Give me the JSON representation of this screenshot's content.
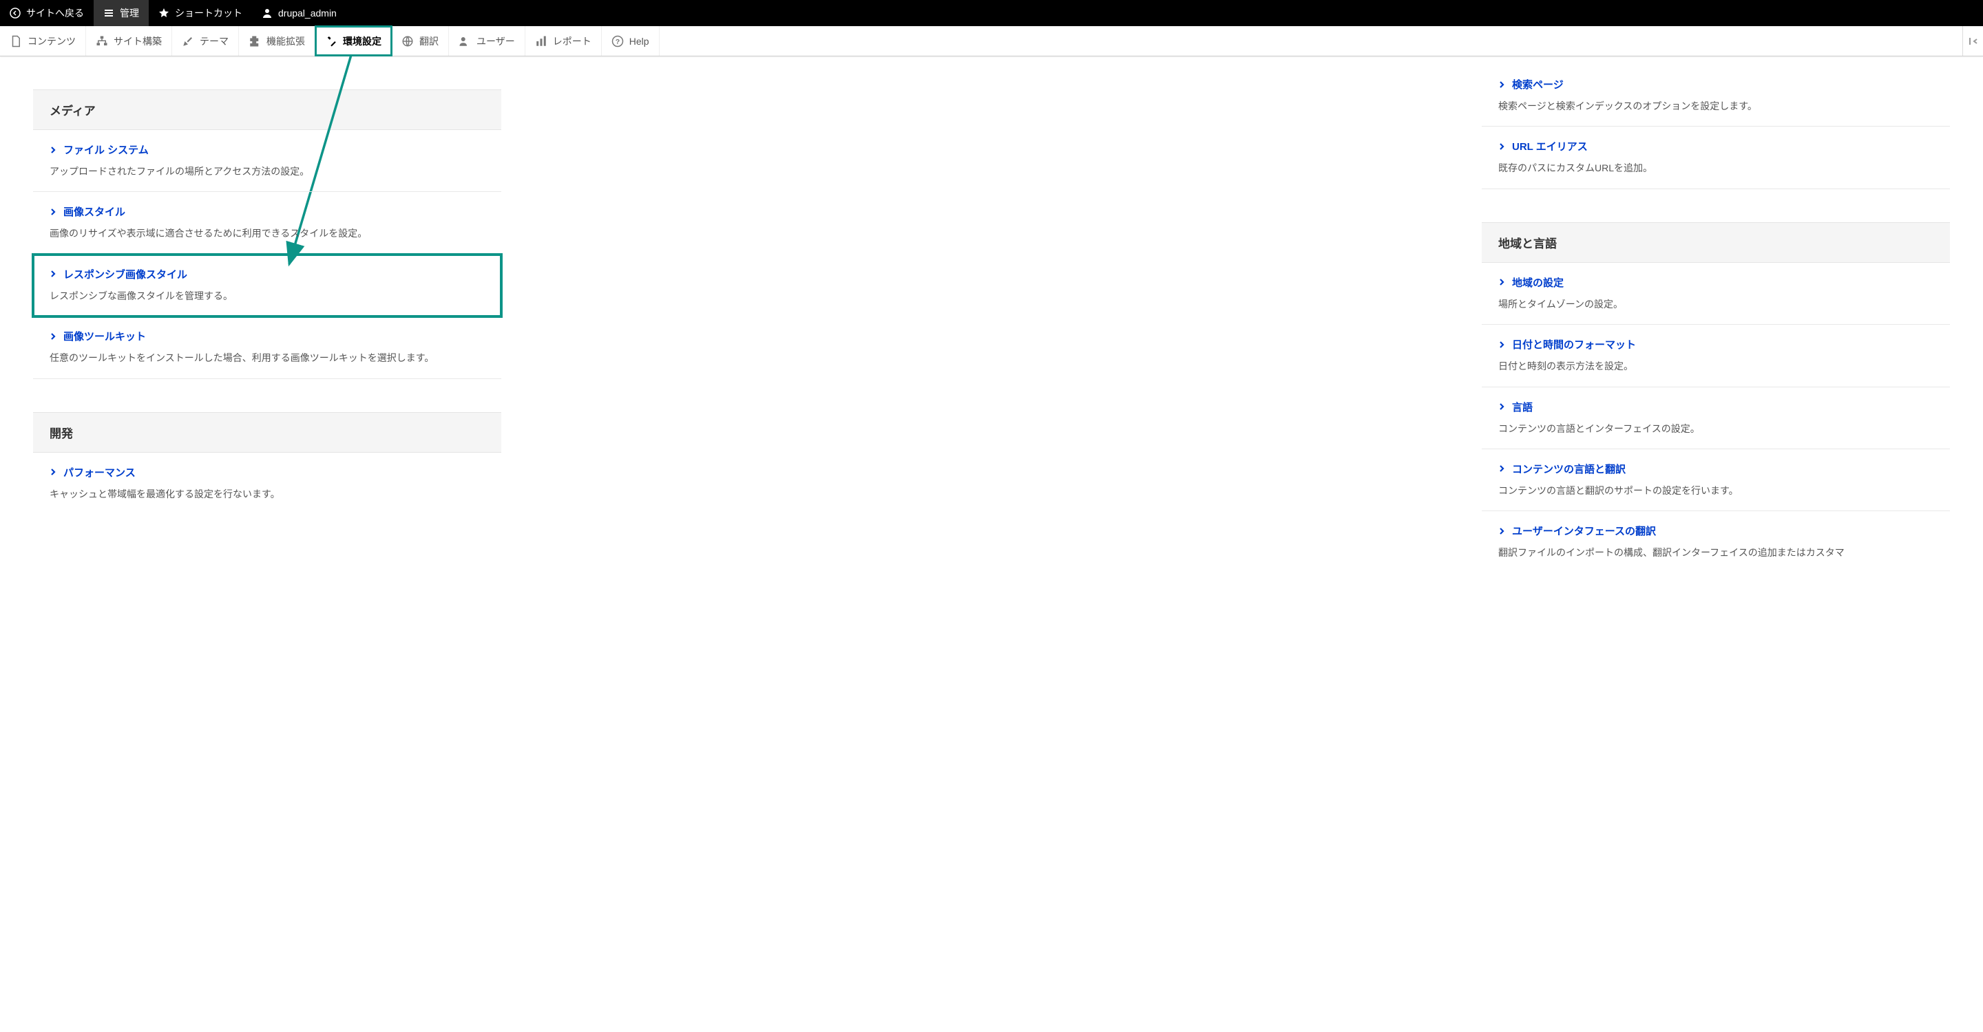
{
  "topbar": {
    "back": "サイトへ戻る",
    "manage": "管理",
    "shortcuts": "ショートカット",
    "user": "drupal_admin"
  },
  "adminbar": {
    "content": "コンテンツ",
    "structure": "サイト構築",
    "appearance": "テーマ",
    "extend": "機能拡張",
    "config": "環境設定",
    "translate": "翻訳",
    "people": "ユーザー",
    "reports": "レポート",
    "help": "Help"
  },
  "left": {
    "media": {
      "heading": "メディア",
      "items": [
        {
          "title": "ファイル システム",
          "desc": "アップロードされたファイルの場所とアクセス方法の設定。"
        },
        {
          "title": "画像スタイル",
          "desc": "画像のリサイズや表示域に適合させるために利用できるスタイルを設定。"
        },
        {
          "title": "レスポンシブ画像スタイル",
          "desc": "レスポンシブな画像スタイルを管理する。"
        },
        {
          "title": "画像ツールキット",
          "desc": "任意のツールキットをインストールした場合、利用する画像ツールキットを選択します。"
        }
      ]
    },
    "dev": {
      "heading": "開発",
      "items": [
        {
          "title": "パフォーマンス",
          "desc": "キャッシュと帯域幅を最適化する設定を行ないます。"
        }
      ]
    }
  },
  "right": {
    "search_items": [
      {
        "title": "検索ページ",
        "desc": "検索ページと検索インデックスのオプションを設定します。"
      },
      {
        "title": "URL エイリアス",
        "desc": "既存のパスにカスタムURLを追加。"
      }
    ],
    "region": {
      "heading": "地域と言語",
      "items": [
        {
          "title": "地域の設定",
          "desc": "場所とタイムゾーンの設定。"
        },
        {
          "title": "日付と時間のフォーマット",
          "desc": "日付と時刻の表示方法を設定。"
        },
        {
          "title": "言語",
          "desc": "コンテンツの言語とインターフェイスの設定。"
        },
        {
          "title": "コンテンツの言語と翻訳",
          "desc": "コンテンツの言語と翻訳のサポートの設定を行います。"
        },
        {
          "title": "ユーザーインタフェースの翻訳",
          "desc": "翻訳ファイルのインポートの構成、翻訳インターフェイスの追加またはカスタマ"
        }
      ]
    }
  }
}
